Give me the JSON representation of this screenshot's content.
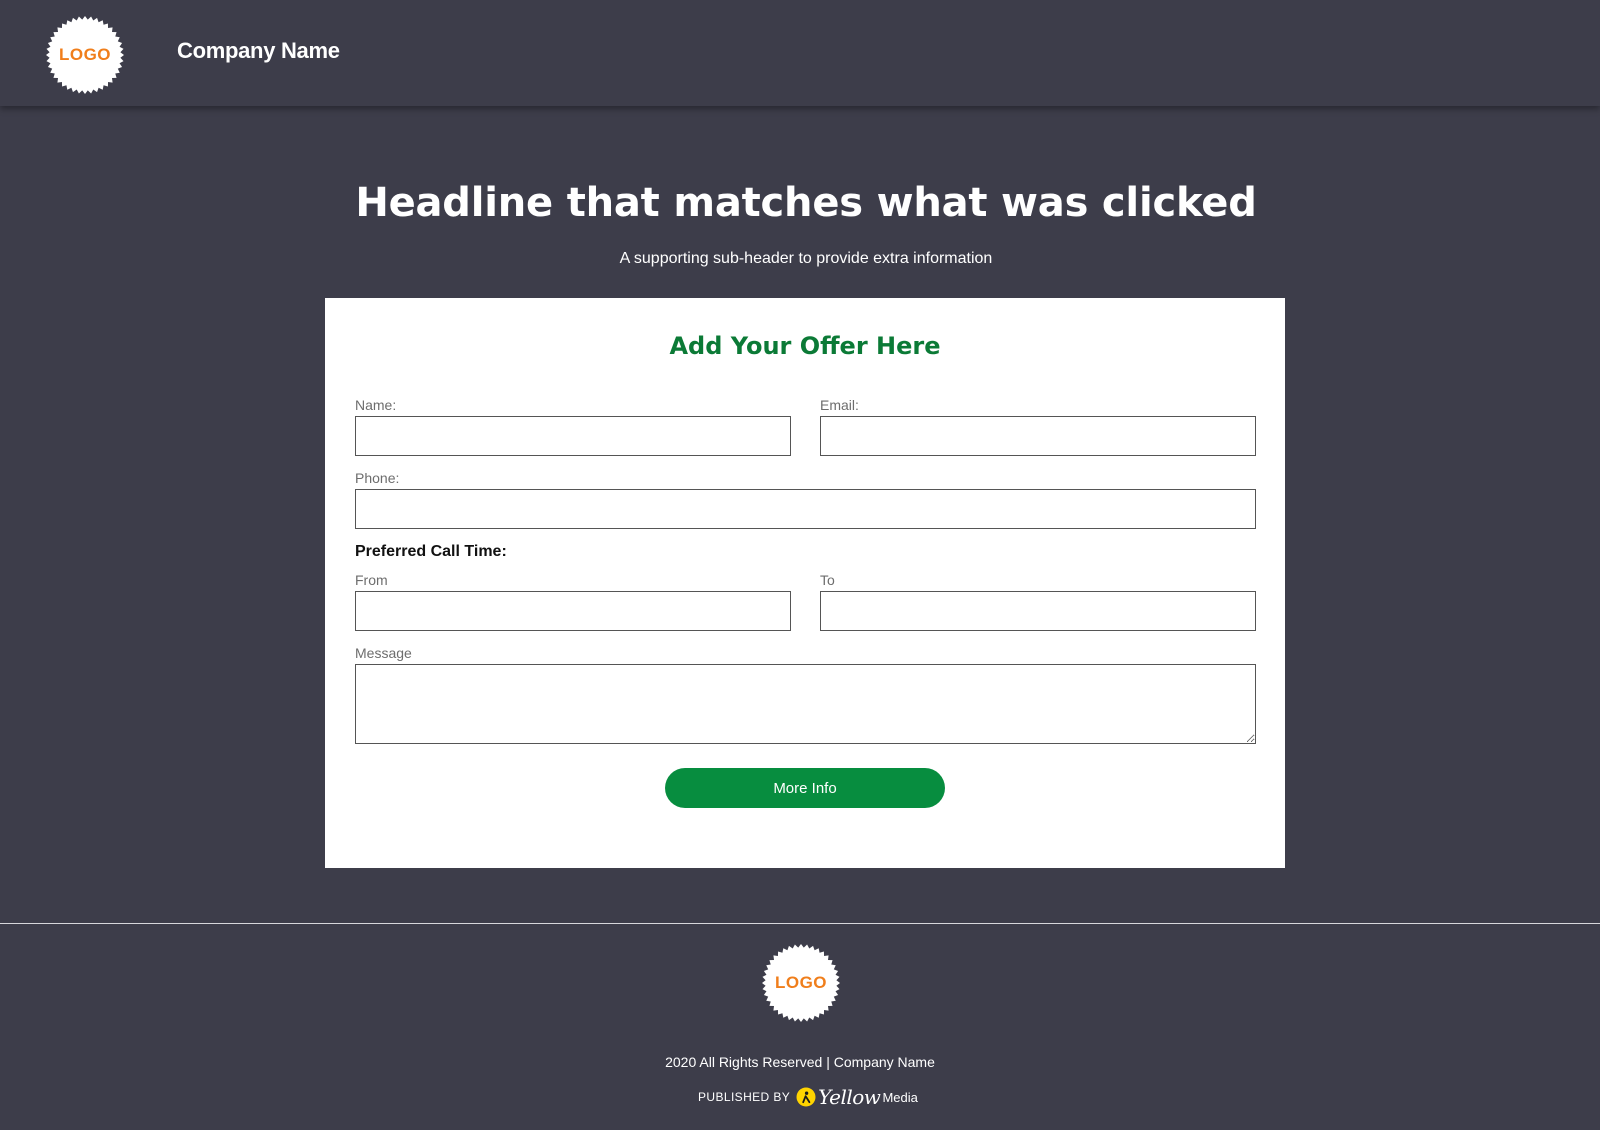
{
  "header": {
    "logo_text": "LOGO",
    "company_name": "Company Name"
  },
  "hero": {
    "title": "Headline that matches what was clicked",
    "subtitle": "A supporting sub-header to provide extra information"
  },
  "form": {
    "offer_title": "Add Your Offer Here",
    "name_label": "Name:",
    "name_value": "",
    "email_label": "Email:",
    "email_value": "",
    "phone_label": "Phone:",
    "phone_value": "",
    "call_time_heading": "Preferred Call Time:",
    "from_label": "From",
    "from_value": "",
    "to_label": "To",
    "to_value": "",
    "message_label": "Message",
    "message_value": "",
    "submit_label": "More Info"
  },
  "footer": {
    "logo_text": "LOGO",
    "copyright": "2020 All Rights Reserved | Company Name",
    "published_by": "PUBLISHED BY",
    "brand_name": "Yellow",
    "brand_suffix": "Media"
  },
  "colors": {
    "background": "#3d3d4a",
    "card": "#ffffff",
    "offer_title": "#0b7a36",
    "button": "#078d3f",
    "logo_text": "#f07e1b",
    "brand_yellow": "#ffd400"
  },
  "icons": {
    "header_logo": "seal-badge",
    "footer_logo": "seal-badge",
    "publisher_icon": "walking-fingers-icon"
  }
}
